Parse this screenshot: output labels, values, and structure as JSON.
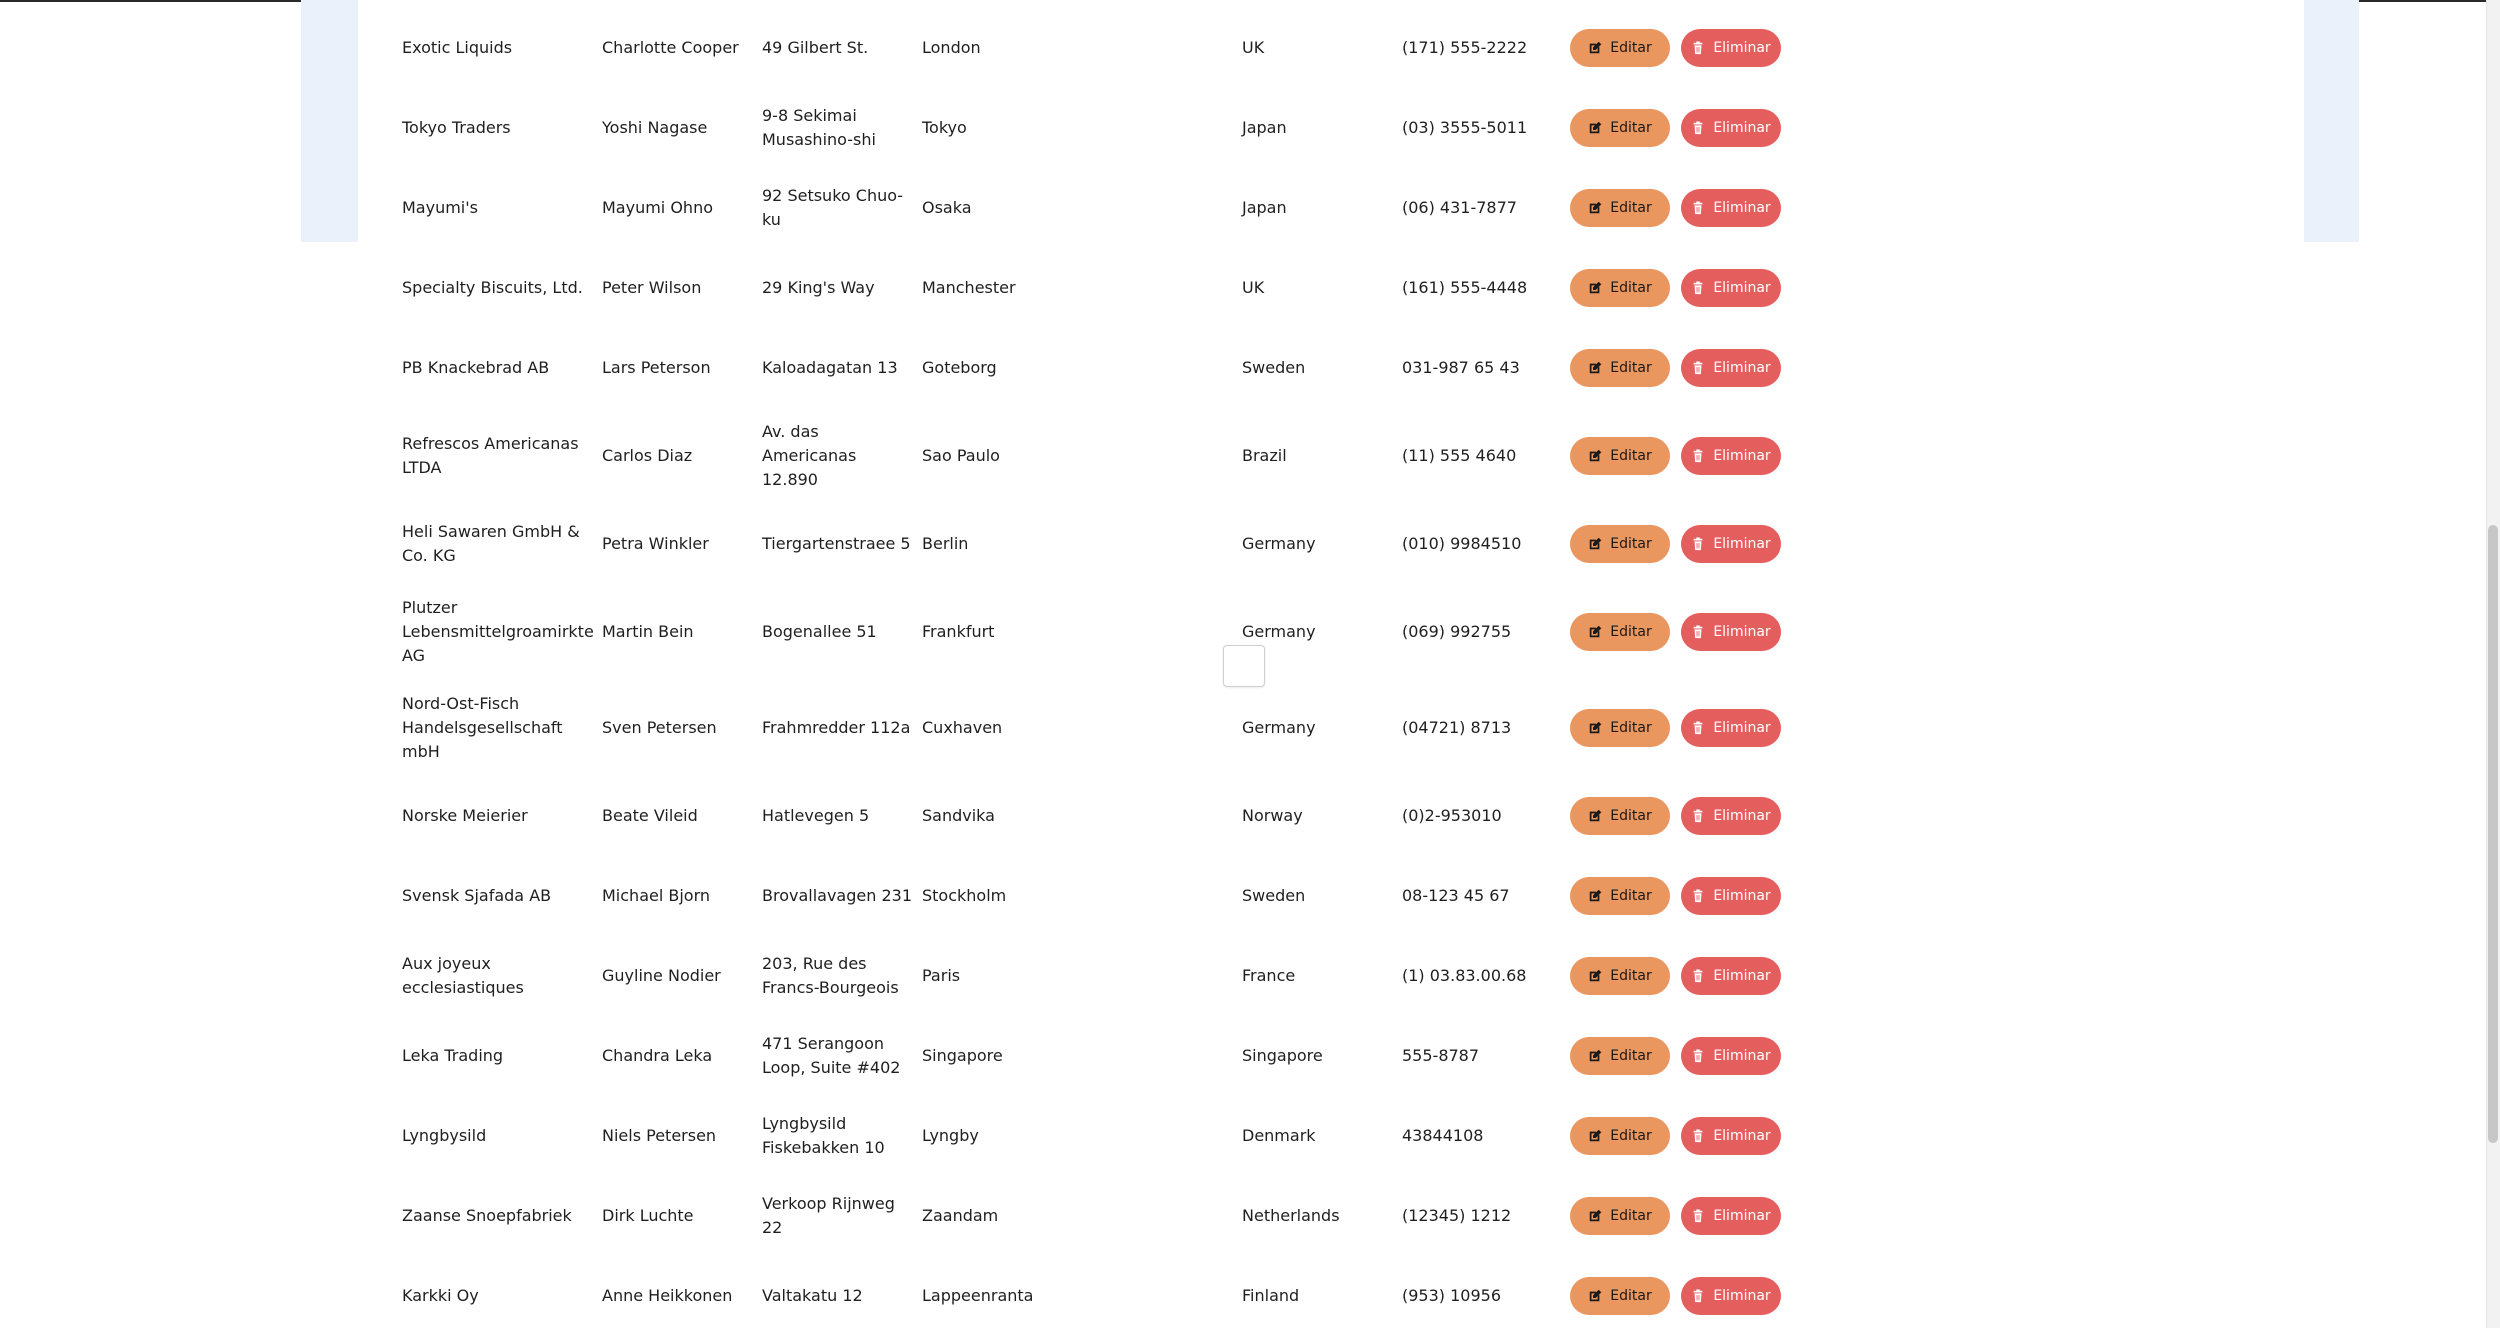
{
  "actions": {
    "edit_label": "Editar",
    "delete_label": "Eliminar"
  },
  "colors": {
    "edit_button": "#e9975f",
    "delete_button": "#e55e5e",
    "band_background": "#eaf1fb"
  },
  "rows": [
    {
      "company": "Exotic Liquids",
      "contact": "Charlotte Cooper",
      "address": "49 Gilbert St.",
      "city": "London",
      "country": "UK",
      "phone": "(171) 555-2222"
    },
    {
      "company": "Tokyo Traders",
      "contact": "Yoshi Nagase",
      "address": "9-8 Sekimai\nMusashino-shi",
      "city": "Tokyo",
      "country": "Japan",
      "phone": "(03) 3555-5011"
    },
    {
      "company": "Mayumi's",
      "contact": "Mayumi Ohno",
      "address": "92 Setsuko Chuo-\nku",
      "city": "Osaka",
      "country": "Japan",
      "phone": "(06) 431-7877"
    },
    {
      "company": "Specialty Biscuits, Ltd.",
      "contact": "Peter Wilson",
      "address": "29 King's Way",
      "city": "Manchester",
      "country": "UK",
      "phone": "(161) 555-4448"
    },
    {
      "company": "PB Knackebrad AB",
      "contact": "Lars Peterson",
      "address": "Kaloadagatan 13",
      "city": "Goteborg",
      "country": "Sweden",
      "phone": "031-987 65 43"
    },
    {
      "company": "Refrescos Americanas\nLTDA",
      "contact": "Carlos Diaz",
      "address": "Av. das\nAmericanas\n12.890",
      "city": "Sao Paulo",
      "country": "Brazil",
      "phone": "(11) 555 4640"
    },
    {
      "company": "Heli Sawaren GmbH &\nCo. KG",
      "contact": "Petra Winkler",
      "address": "Tiergartenstraee 5",
      "city": "Berlin",
      "country": "Germany",
      "phone": "(010) 9984510"
    },
    {
      "company": "Plutzer\nLebensmittelgroamirkte\nAG",
      "contact": "Martin Bein",
      "address": "Bogenallee 51",
      "city": "Frankfurt",
      "country": "Germany",
      "phone": "(069) 992755"
    },
    {
      "company": "Nord-Ost-Fisch\nHandelsgesellschaft\nmbH",
      "contact": "Sven Petersen",
      "address": "Frahmredder 112a",
      "city": "Cuxhaven",
      "country": "Germany",
      "phone": "(04721) 8713"
    },
    {
      "company": "Norske Meierier",
      "contact": "Beate Vileid",
      "address": "Hatlevegen 5",
      "city": "Sandvika",
      "country": "Norway",
      "phone": "(0)2-953010"
    },
    {
      "company": "Svensk Sjafada AB",
      "contact": "Michael Bjorn",
      "address": "Brovallavagen 231",
      "city": "Stockholm",
      "country": "Sweden",
      "phone": "08-123 45 67"
    },
    {
      "company": "Aux joyeux\necclesiastiques",
      "contact": "Guyline Nodier",
      "address": "203, Rue des\nFrancs-Bourgeois",
      "city": "Paris",
      "country": "France",
      "phone": "(1) 03.83.00.68"
    },
    {
      "company": "Leka Trading",
      "contact": "Chandra Leka",
      "address": "471 Serangoon\nLoop, Suite #402",
      "city": "Singapore",
      "country": "Singapore",
      "phone": "555-8787"
    },
    {
      "company": "Lyngbysild",
      "contact": "Niels Petersen",
      "address": "Lyngbysild\nFiskebakken 10",
      "city": "Lyngby",
      "country": "Denmark",
      "phone": "43844108"
    },
    {
      "company": "Zaanse Snoepfabriek",
      "contact": "Dirk Luchte",
      "address": "Verkoop Rijnweg\n22",
      "city": "Zaandam",
      "country": "Netherlands",
      "phone": "(12345) 1212"
    },
    {
      "company": "Karkki Oy",
      "contact": "Anne Heikkonen",
      "address": "Valtakatu 12",
      "city": "Lappeenranta",
      "country": "Finland",
      "phone": "(953) 10956"
    }
  ]
}
